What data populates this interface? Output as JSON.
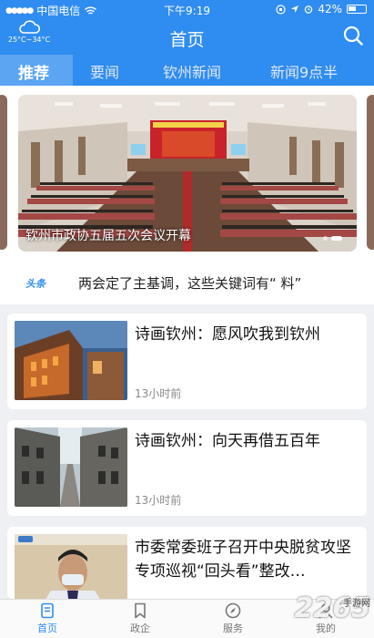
{
  "status_bar": {
    "carrier": "中国电信",
    "time": "下午9:19",
    "battery": "42%"
  },
  "header": {
    "title": "首页",
    "weather_temp": "25°C~34°C"
  },
  "tabs": [
    {
      "label": "推荐",
      "active": true
    },
    {
      "label": "要闻",
      "active": false
    },
    {
      "label": "钦州新闻",
      "active": false
    },
    {
      "label": "新闻9点半",
      "active": false
    }
  ],
  "banner": {
    "caption": "钦州市政协五届五次会议开幕",
    "pages": 2,
    "current_page": 2
  },
  "headline": {
    "badge": "头条",
    "text": "两会定了主基调，这些关键词有“ 料”"
  },
  "news": [
    {
      "title": "诗画钦州：愿风吹我到钦州",
      "time": "13小时前"
    },
    {
      "title": "诗画钦州：向天再借五百年",
      "time": "13小时前"
    },
    {
      "title": "市委常委班子召开中央脱贫攻坚专项巡视“回头看”整改…",
      "time": ""
    }
  ],
  "tabbar": [
    {
      "label": "首页",
      "icon": "home-doc-icon",
      "active": true
    },
    {
      "label": "政企",
      "icon": "bookmark-icon",
      "active": false
    },
    {
      "label": "服务",
      "icon": "compass-icon",
      "active": false
    },
    {
      "label": "我的",
      "icon": "user-icon",
      "active": false
    }
  ],
  "watermark": {
    "number": "2265",
    "suffix": "手游网"
  },
  "colors": {
    "brand_blue": "#2f8cf0",
    "background": "#eef0f3"
  }
}
